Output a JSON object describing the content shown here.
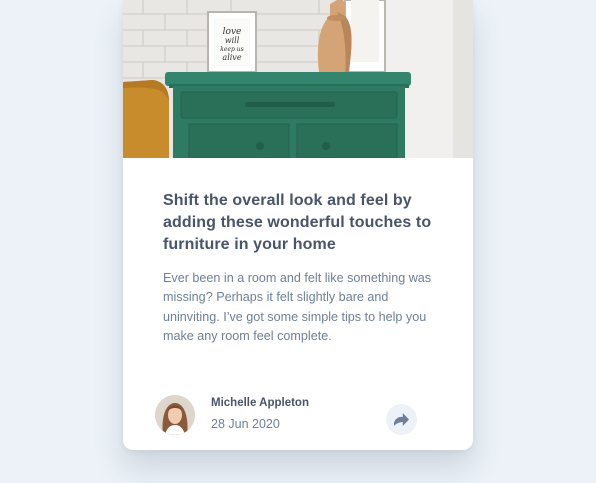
{
  "article": {
    "title": "Shift the overall look and feel by adding these wonderful touches to furniture in your home",
    "excerpt": "Ever been in a room and felt like something was missing? Perhaps it felt slightly bare and uninviting. I’ve got some simple tips to help you make any room feel complete."
  },
  "author": {
    "name": "Michelle Appleton",
    "date": "28 Jun 2020"
  },
  "hero": {
    "frame_text": [
      "love",
      "will",
      "keep us",
      "alive"
    ]
  },
  "icons": {
    "share": "share-icon"
  },
  "colors": {
    "page_background": "#ecf2f8",
    "heading": "#48556a",
    "body_text": "#6e8098",
    "drawer_green": "#2e7a63"
  }
}
